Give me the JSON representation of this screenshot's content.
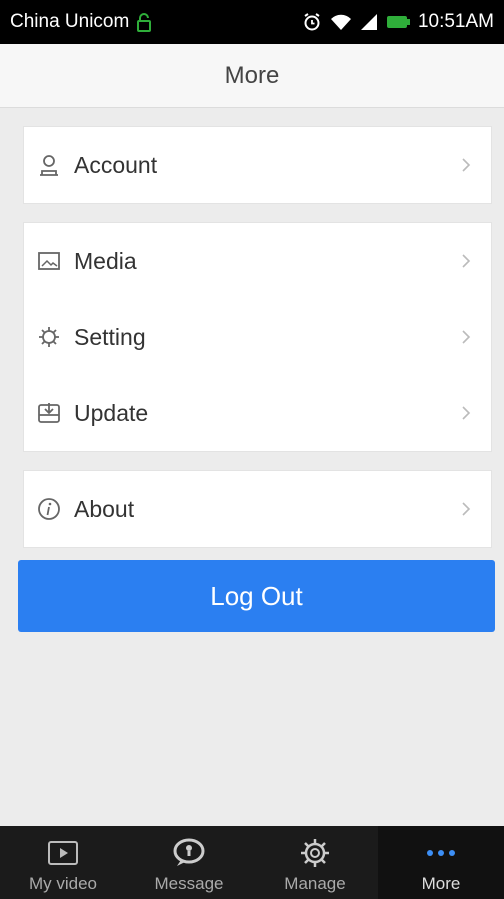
{
  "status_bar": {
    "carrier": "China Unicom",
    "time": "10:51AM"
  },
  "header": {
    "title": "More"
  },
  "groups": [
    {
      "items": [
        {
          "label": "Account",
          "icon": "user-icon"
        }
      ]
    },
    {
      "items": [
        {
          "label": "Media",
          "icon": "image-icon"
        },
        {
          "label": "Setting",
          "icon": "gear-icon"
        },
        {
          "label": "Update",
          "icon": "download-icon"
        }
      ]
    },
    {
      "items": [
        {
          "label": "About",
          "icon": "info-icon"
        }
      ]
    }
  ],
  "logout": {
    "label": "Log Out"
  },
  "tabs": [
    {
      "label": "My video",
      "icon": "video-icon"
    },
    {
      "label": "Message",
      "icon": "message-icon"
    },
    {
      "label": "Manage",
      "icon": "manage-gear-icon"
    },
    {
      "label": "More",
      "icon": "more-dots-icon",
      "active": true
    }
  ],
  "colors": {
    "accent": "#2b7ff1",
    "tab_active_icon": "#3d8ff5",
    "background": "#ececec"
  }
}
